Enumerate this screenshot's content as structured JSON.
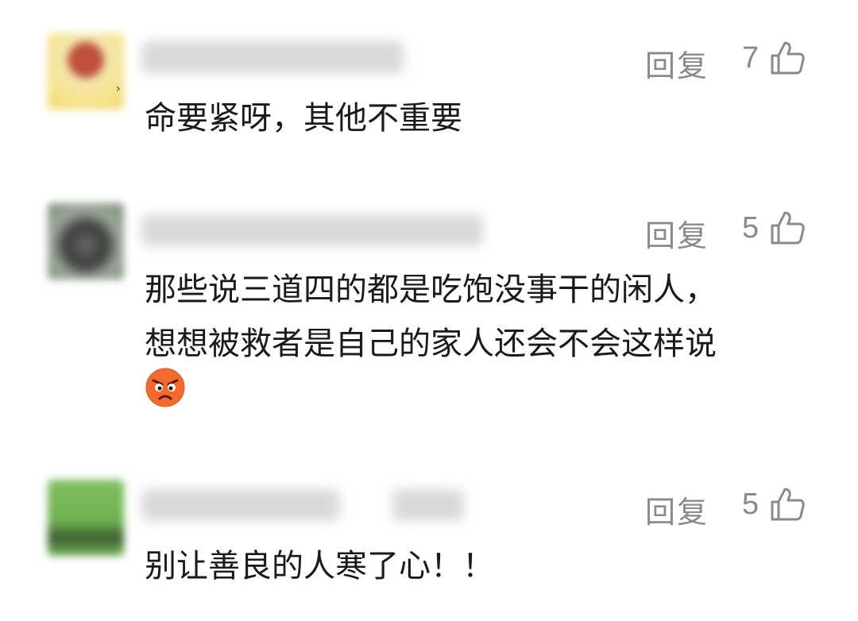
{
  "comments": [
    {
      "reply_label": "回复",
      "like_count": "7",
      "lines": [
        "命要紧呀，其他不重要"
      ]
    },
    {
      "reply_label": "回复",
      "like_count": "5",
      "lines": [
        "那些说三道四的都是吃饱没事干的闲人，",
        "想想被救者是自己的家人还会不会这样说"
      ],
      "emoji": "angry-face"
    },
    {
      "reply_label": "回复",
      "like_count": "5",
      "lines": [
        "别让善良的人寒了心！！"
      ]
    }
  ],
  "colors": {
    "meta_text": "#8a8a8a",
    "body_text": "#1a1a1a",
    "emoji_orange": "#f26a2e"
  }
}
